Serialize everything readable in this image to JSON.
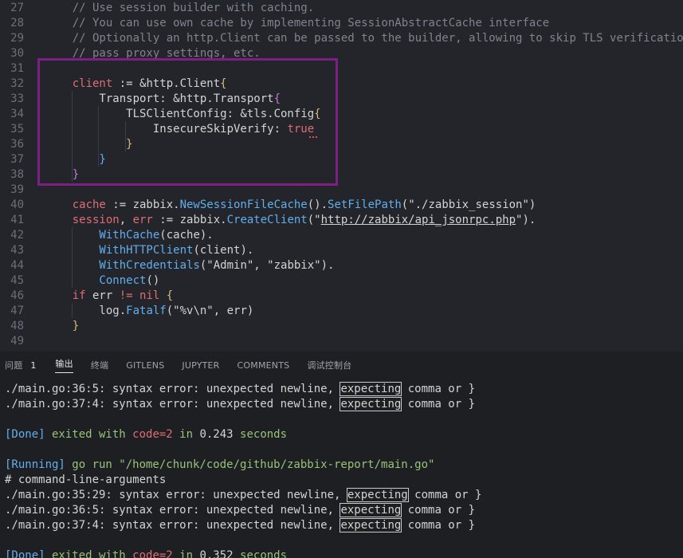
{
  "editor": {
    "lines": [
      {
        "n": "27",
        "parts": [
          [
            "c",
            "    // Use session builder with caching."
          ]
        ]
      },
      {
        "n": "28",
        "parts": [
          [
            "c",
            "    // You can use own cache by implementing SessionAbstractCache interface"
          ]
        ]
      },
      {
        "n": "29",
        "parts": [
          [
            "c",
            "    // Optionally an http.Client can be passed to the builder, allowing to skip TLS verification,"
          ]
        ]
      },
      {
        "n": "30",
        "parts": [
          [
            "c",
            "    // pass proxy settings, etc."
          ]
        ]
      },
      {
        "n": "31",
        "parts": []
      },
      {
        "n": "32",
        "parts": [
          [
            "k",
            "    client"
          ],
          [
            "op",
            " := &http.Client"
          ],
          [
            "paren",
            "{"
          ]
        ]
      },
      {
        "n": "33",
        "parts": [
          [
            "op",
            "        Transport: &http.Transport"
          ],
          [
            "kw",
            "{"
          ]
        ]
      },
      {
        "n": "34",
        "parts": [
          [
            "op",
            "            TLSClientConfig: &tls.Config"
          ],
          [
            "paren",
            "{"
          ]
        ]
      },
      {
        "n": "35",
        "parts": [
          [
            "op",
            "                InsecureSkipVerify: "
          ],
          [
            "k",
            "true"
          ]
        ]
      },
      {
        "n": "36",
        "parts": [
          [
            "paren",
            "            }"
          ]
        ]
      },
      {
        "n": "37",
        "parts": [
          [
            "f",
            "        }"
          ]
        ]
      },
      {
        "n": "38",
        "parts": [
          [
            "kw",
            "    }"
          ]
        ]
      },
      {
        "n": "39",
        "parts": []
      },
      {
        "n": "40",
        "parts": [
          [
            "k",
            "    cache"
          ],
          [
            "op",
            " := zabbix."
          ],
          [
            "f",
            "NewSessionFileCache"
          ],
          [
            "op",
            "()."
          ],
          [
            "f",
            "SetFilePath"
          ],
          [
            "op",
            "("
          ],
          [
            "s",
            "\"./zabbix_session\""
          ],
          [
            "op",
            ")"
          ]
        ]
      },
      {
        "n": "41",
        "parts": [
          [
            "k",
            "    session"
          ],
          [
            "op",
            ", "
          ],
          [
            "k",
            "err"
          ],
          [
            "op",
            " := zabbix."
          ],
          [
            "f",
            "CreateClient"
          ],
          [
            "op",
            "(\""
          ],
          [
            "su",
            "http://zabbix/api_jsonrpc.php"
          ],
          [
            "op",
            "\")."
          ]
        ]
      },
      {
        "n": "42",
        "parts": [
          [
            "f",
            "        WithCache"
          ],
          [
            "op",
            "(cache)."
          ]
        ]
      },
      {
        "n": "43",
        "parts": [
          [
            "f",
            "        WithHTTPClient"
          ],
          [
            "op",
            "(client)."
          ]
        ]
      },
      {
        "n": "44",
        "parts": [
          [
            "f",
            "        WithCredentials"
          ],
          [
            "op",
            "(\"Admin\", \"zabbix\")."
          ]
        ]
      },
      {
        "n": "45",
        "parts": [
          [
            "f",
            "        Connect"
          ],
          [
            "op",
            "()"
          ]
        ]
      },
      {
        "n": "46",
        "parts": [
          [
            "k",
            "    if"
          ],
          [
            "op",
            " err "
          ],
          [
            "k",
            "!="
          ],
          [
            "op",
            " "
          ],
          [
            "k",
            "nil"
          ],
          [
            "op",
            " "
          ],
          [
            "paren",
            "{"
          ]
        ]
      },
      {
        "n": "47",
        "parts": [
          [
            "op",
            "        log."
          ],
          [
            "f",
            "Fatalf"
          ],
          [
            "op",
            "(\"%v\\n\", err)"
          ]
        ]
      },
      {
        "n": "48",
        "parts": [
          [
            "paren",
            "    }"
          ]
        ]
      },
      {
        "n": "49",
        "parts": []
      }
    ]
  },
  "panel": {
    "tabs": [
      {
        "label": "问题",
        "badge": "1",
        "active": false
      },
      {
        "label": "输出",
        "active": true
      },
      {
        "label": "终端",
        "active": false
      },
      {
        "label": "GITLENS",
        "active": false
      },
      {
        "label": "JUPYTER",
        "active": false
      },
      {
        "label": "COMMENTS",
        "active": false
      },
      {
        "label": "调试控制台",
        "active": false
      }
    ]
  },
  "output": {
    "lines": [
      {
        "parts": [
          [
            "t",
            "./main.go:36:5: syntax error: unexpected newline, "
          ],
          [
            "box",
            "expecting"
          ],
          [
            "t",
            " comma or }"
          ]
        ]
      },
      {
        "parts": [
          [
            "t",
            "./main.go:37:4: syntax error: unexpected newline, "
          ],
          [
            "box",
            "expecting"
          ],
          [
            "t",
            " comma or }"
          ]
        ]
      },
      {
        "parts": []
      },
      {
        "parts": [
          [
            "status",
            "[Done]"
          ],
          [
            "green",
            " exited with "
          ],
          [
            "red",
            "code=2"
          ],
          [
            "green",
            " in "
          ],
          [
            "t",
            "0.243"
          ],
          [
            "green",
            " seconds"
          ]
        ]
      },
      {
        "parts": []
      },
      {
        "parts": [
          [
            "status",
            "[Running]"
          ],
          [
            "green",
            " go run \"/home/chunk/code/github/zabbix-report/main.go\""
          ]
        ]
      },
      {
        "parts": [
          [
            "t",
            "# command-line-arguments"
          ]
        ]
      },
      {
        "parts": [
          [
            "t",
            "./main.go:35:29: syntax error: unexpected newline, "
          ],
          [
            "boxcur",
            "expecting"
          ],
          [
            "t",
            " comma or }"
          ]
        ]
      },
      {
        "parts": [
          [
            "t",
            "./main.go:36:5: syntax error: unexpected newline, "
          ],
          [
            "box",
            "expecting"
          ],
          [
            "t",
            " comma or }"
          ]
        ]
      },
      {
        "parts": [
          [
            "t",
            "./main.go:37:4: syntax error: unexpected newline, "
          ],
          [
            "box",
            "expecting"
          ],
          [
            "t",
            " comma or }"
          ]
        ]
      },
      {
        "parts": []
      },
      {
        "parts": [
          [
            "status",
            "[Done]"
          ],
          [
            "green",
            " exited with "
          ],
          [
            "red",
            "code=2"
          ],
          [
            "green",
            " in "
          ],
          [
            "t",
            "0.352"
          ],
          [
            "green",
            " seconds"
          ]
        ]
      }
    ]
  }
}
